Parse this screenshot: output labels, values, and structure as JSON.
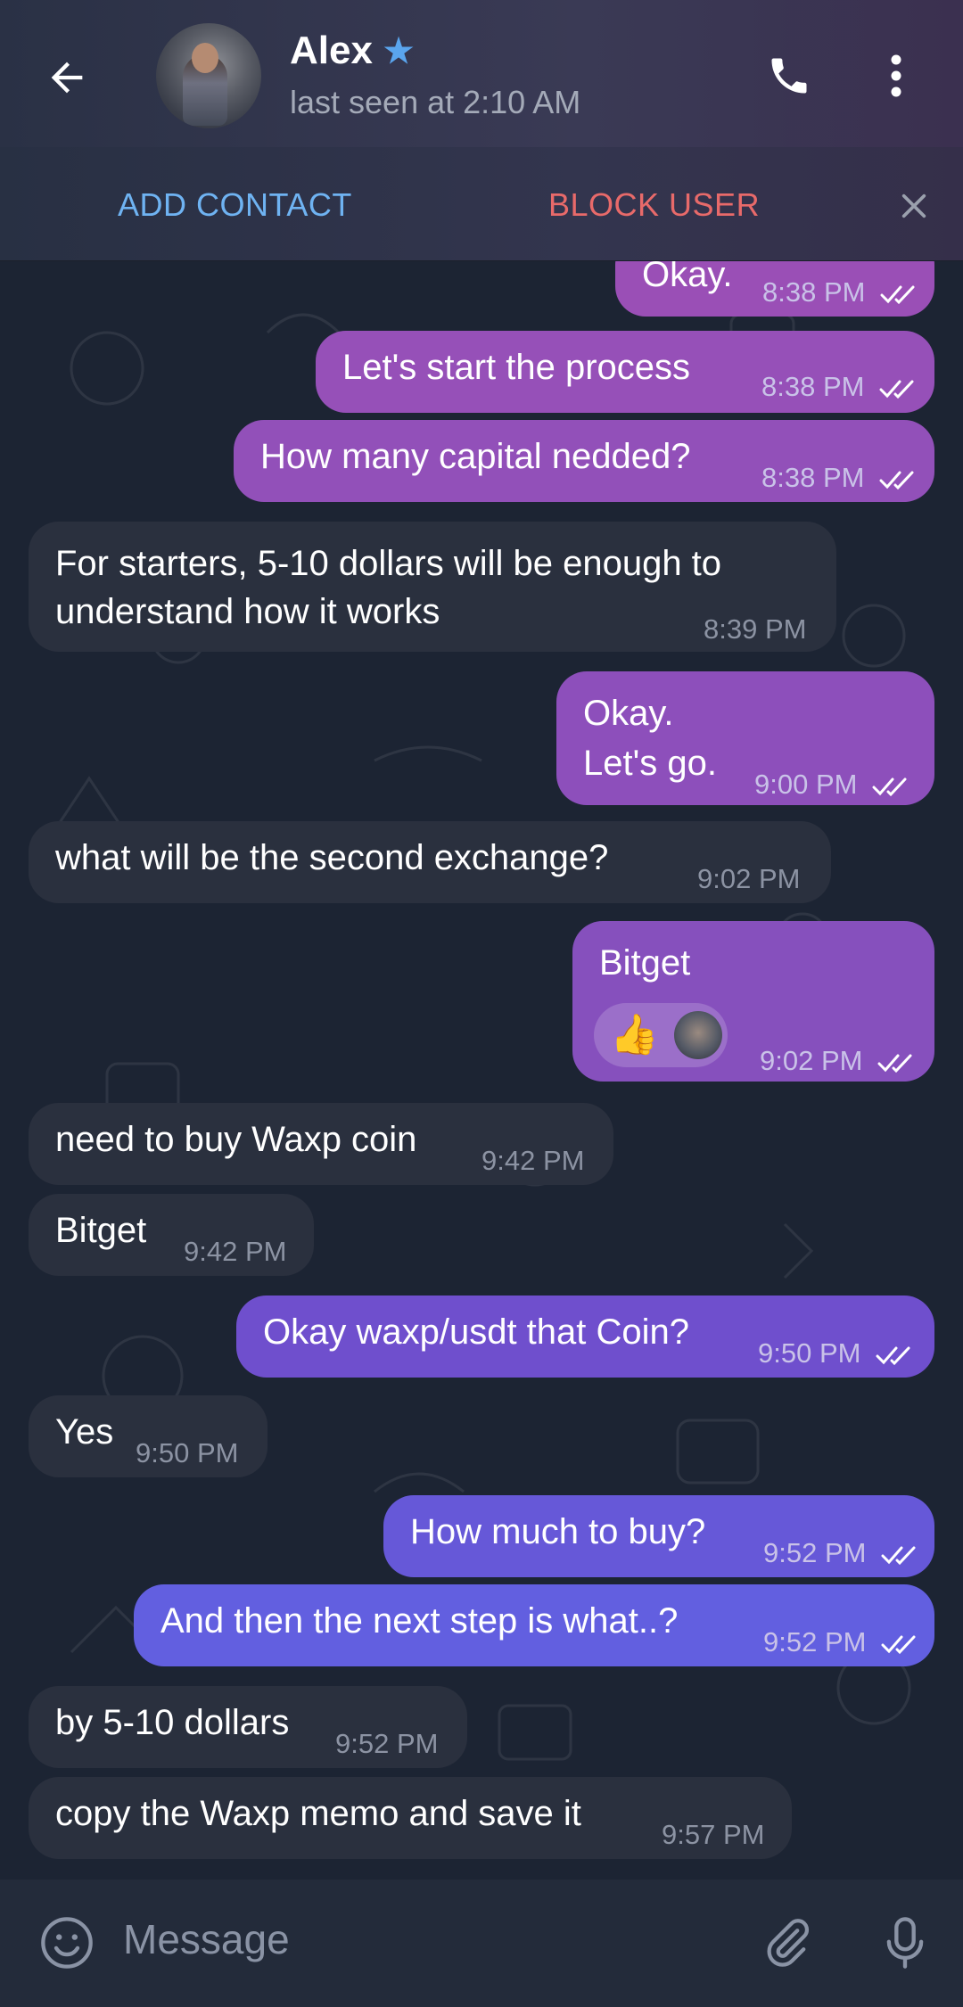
{
  "header": {
    "contact_name": "Alex",
    "last_seen": "last seen at 2:10 AM"
  },
  "action_bar": {
    "add_contact": "ADD CONTACT",
    "block_user": "BLOCK USER"
  },
  "messages": [
    {
      "dir": "out",
      "text": "Okay.",
      "time": "8:38 PM",
      "read": true
    },
    {
      "dir": "out",
      "text": "Let's start the process",
      "time": "8:38 PM",
      "read": true
    },
    {
      "dir": "out",
      "text": "How many capital nedded?",
      "time": "8:38 PM",
      "read": true
    },
    {
      "dir": "in",
      "lines": [
        "For starters, 5-10 dollars will be enough to",
        "understand how it works"
      ],
      "time": "8:39 PM"
    },
    {
      "dir": "out",
      "lines": [
        "Okay.",
        "Let's go."
      ],
      "time": "9:00 PM",
      "read": true
    },
    {
      "dir": "in",
      "text": "what will be the second exchange?",
      "time": "9:02 PM"
    },
    {
      "dir": "out",
      "text": "Bitget",
      "time": "9:02 PM",
      "read": true,
      "reaction": "👍"
    },
    {
      "dir": "in",
      "text": "need to buy Waxp coin",
      "time": "9:42 PM"
    },
    {
      "dir": "in",
      "text": "Bitget",
      "time": "9:42 PM"
    },
    {
      "dir": "out",
      "text": "Okay waxp/usdt that Coin?",
      "time": "9:50 PM",
      "read": true
    },
    {
      "dir": "in",
      "text": "Yes",
      "time": "9:50 PM"
    },
    {
      "dir": "out",
      "text": "How much to buy?",
      "time": "9:52 PM",
      "read": true
    },
    {
      "dir": "out",
      "text": "And then the next step is what..?",
      "time": "9:52 PM",
      "read": true
    },
    {
      "dir": "in",
      "text": "by 5-10 dollars",
      "time": "9:52 PM"
    },
    {
      "dir": "in",
      "text": "copy the Waxp memo and save it",
      "time": "9:57 PM"
    }
  ],
  "composer": {
    "placeholder": "Message"
  },
  "colors": {
    "outgoing_top": "#9b50b4",
    "outgoing_bottom": "#6462e0",
    "incoming": "#2a303e",
    "link": "#6fb3f2",
    "danger": "#e86a6a"
  },
  "icons": [
    "back-arrow-icon",
    "star-icon",
    "phone-icon",
    "more-vertical-icon",
    "close-icon",
    "emoji-icon",
    "attach-icon",
    "microphone-icon",
    "double-check-icon"
  ]
}
